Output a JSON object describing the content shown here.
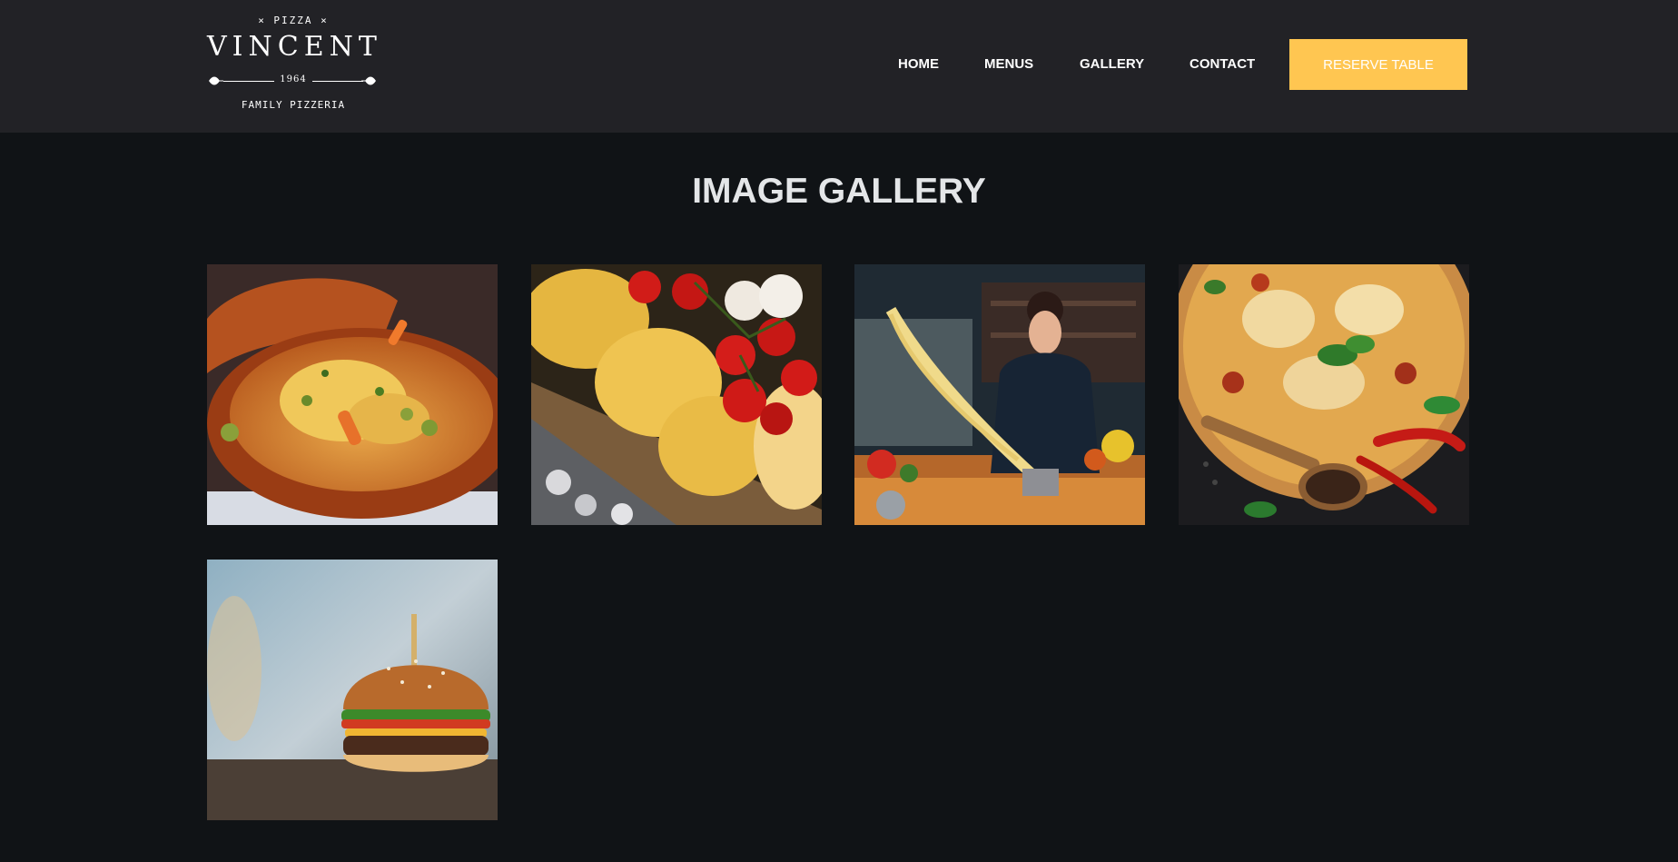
{
  "logo": {
    "top_text": "× PIZZA ×",
    "name": "VINCENT",
    "year": "1964",
    "subtitle": "FAMILY PIZZERIA"
  },
  "nav": {
    "home": "HOME",
    "menus": "MENUS",
    "gallery": "GALLERY",
    "contact": "CONTACT",
    "reserve_label": "RESERVE TABLE"
  },
  "gallery": {
    "title": "IMAGE GALLERY",
    "images": [
      "tagine-dish-photo",
      "fresh-pasta-tomatoes-photo",
      "chef-making-pasta-photo",
      "pizza-spices-photo",
      "burger-photo"
    ]
  },
  "colors": {
    "header_bg": "#222226",
    "page_bg": "#101316",
    "accent": "#ffc651"
  }
}
